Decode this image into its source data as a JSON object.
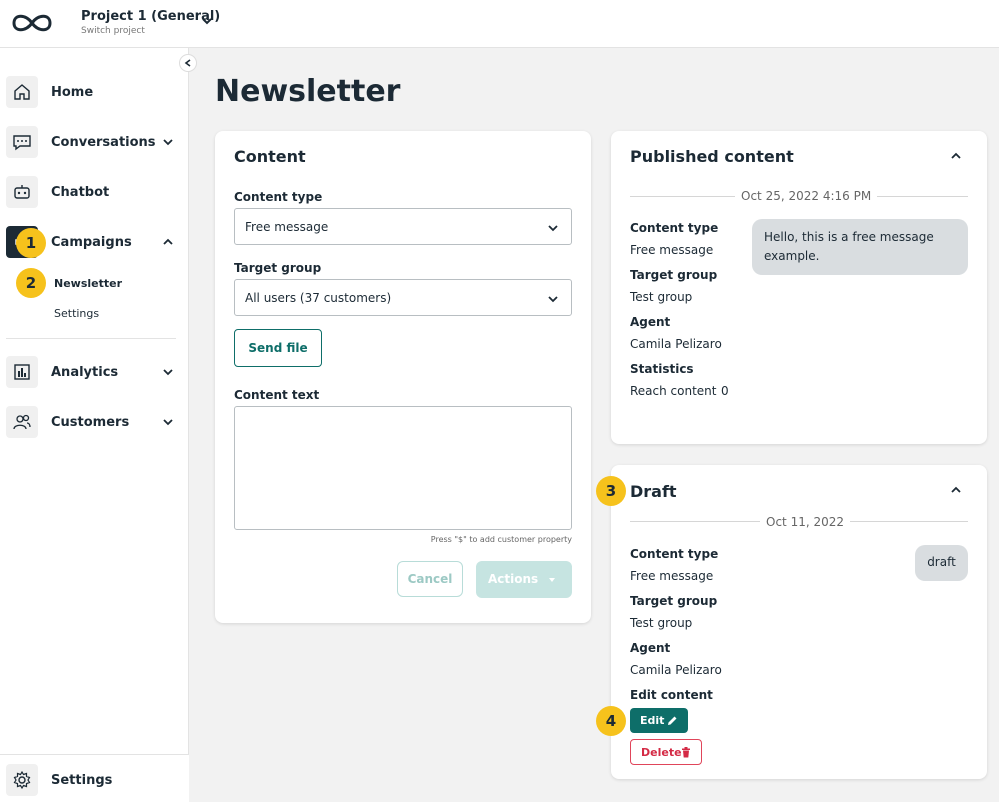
{
  "header": {
    "project_title": "Project 1 (General)",
    "project_subtitle": "Switch project"
  },
  "sidebar": {
    "items": [
      {
        "label": "Home",
        "icon": "home-icon"
      },
      {
        "label": "Conversations",
        "icon": "chat-icon"
      },
      {
        "label": "Chatbot",
        "icon": "robot-icon"
      },
      {
        "label": "Campaigns",
        "icon": "megaphone-icon"
      },
      {
        "label": "Analytics",
        "icon": "bar-chart-icon"
      },
      {
        "label": "Customers",
        "icon": "users-icon"
      }
    ],
    "campaign_subitems": [
      "Newsletter",
      "Settings"
    ],
    "bottom_label": "Settings"
  },
  "badges": [
    "1",
    "2",
    "3",
    "4"
  ],
  "page": {
    "title": "Newsletter"
  },
  "content_card": {
    "title": "Content",
    "content_type_label": "Content type",
    "content_type_value": "Free message",
    "target_group_label": "Target group",
    "target_group_value": "All users (37 customers)",
    "send_file_label": "Send file",
    "content_text_label": "Content text",
    "hint": "Press \"$\" to add customer property",
    "cancel_label": "Cancel",
    "actions_label": "Actions"
  },
  "published_card": {
    "title": "Published content",
    "date": "Oct 25, 2022 4:16 PM",
    "content_type_label": "Content type",
    "content_type_value": "Free message",
    "target_group_label": "Target group",
    "target_group_value": "Test group",
    "agent_label": "Agent",
    "agent_value": "Camila Pelizaro",
    "statistics_label": "Statistics",
    "reach_label": "Reach content",
    "reach_value": "0",
    "bubble_text": "Hello, this is a free message example."
  },
  "draft_card": {
    "title": "Draft",
    "date": "Oct 11, 2022",
    "content_type_label": "Content type",
    "content_type_value": "Free message",
    "target_group_label": "Target group",
    "target_group_value": "Test group",
    "agent_label": "Agent",
    "agent_value": "Camila Pelizaro",
    "edit_content_label": "Edit content",
    "edit_button": "Edit",
    "delete_button": "Delete",
    "bubble_text": "draft"
  },
  "colors": {
    "accent": "#0e6e69",
    "badge": "#f6c21c",
    "danger": "#d42a45",
    "text": "#1c2a35"
  }
}
